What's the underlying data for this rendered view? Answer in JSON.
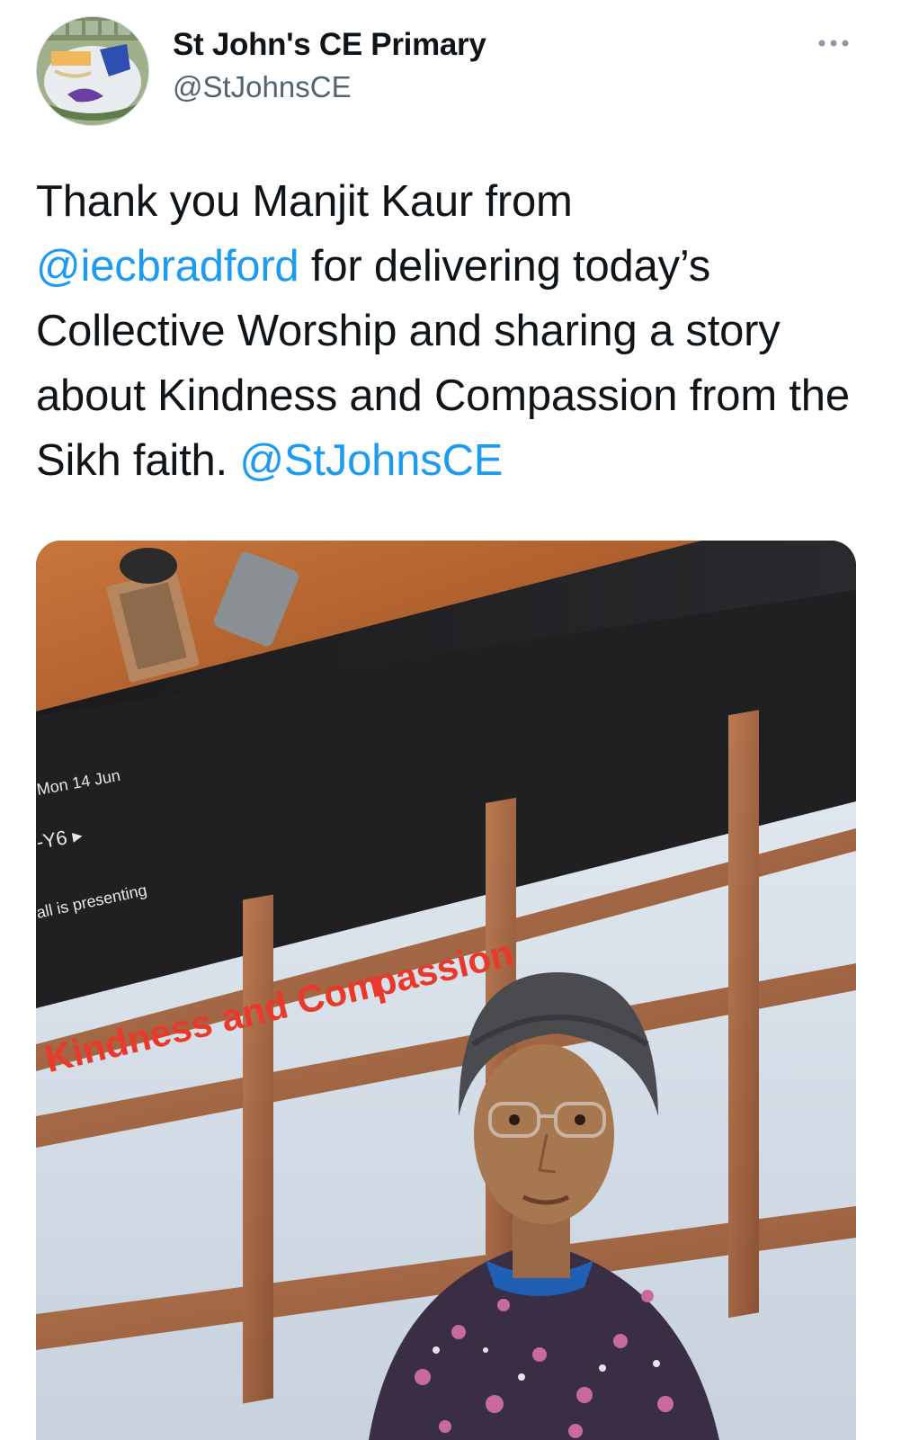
{
  "account": {
    "name": "St John's CE Primary",
    "handle": "@StJohnsCE",
    "avatar_label": "St John's school logo"
  },
  "menu": {
    "more_icon": "more-horizontal-icon"
  },
  "tweet": {
    "text_1": "Thank you Manjit Kaur from",
    "mention_1": "@iecbradford",
    "text_2": " for delivering today’s Collective Worship and sharing a story about Kindness and Compassion from the Sikh faith. ",
    "mention_2": "@StJohnsCE"
  },
  "media": {
    "screen_date": "Mon 14 Jun",
    "screen_class": "-Y6 ▸",
    "screen_presenting": "all is presenting",
    "slide_title_1": "Kindness and Com",
    "slide_title_2": "passion",
    "colors": {
      "slide_title": "#e8392a",
      "mention": "#1d9bf0"
    }
  }
}
